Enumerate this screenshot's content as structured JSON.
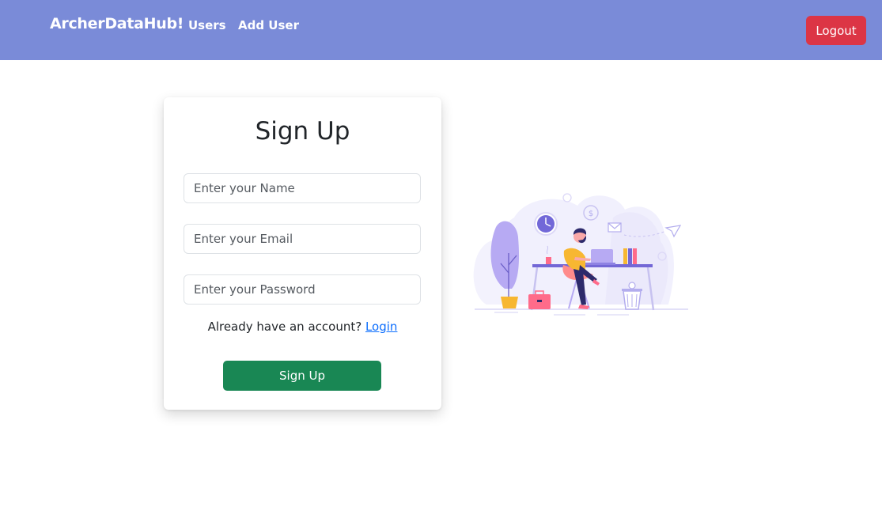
{
  "navbar": {
    "brand": "ArcherDataHub!",
    "links": [
      "Users",
      "Add User"
    ],
    "logout_label": "Logout",
    "logout_color": "#dc3545",
    "background": "#7a8bd8"
  },
  "signup_form": {
    "title": "Sign Up",
    "name_placeholder": "Enter your Name",
    "name_value": "",
    "email_placeholder": "Enter your Email",
    "email_value": "",
    "password_placeholder": "Enter your Password",
    "password_value": "",
    "account_prompt": "Already have an account?",
    "login_link": "Login",
    "submit_label": "Sign Up",
    "submit_color": "#198754"
  },
  "illustration": {
    "icon": "person-working-at-desk-illustration"
  }
}
